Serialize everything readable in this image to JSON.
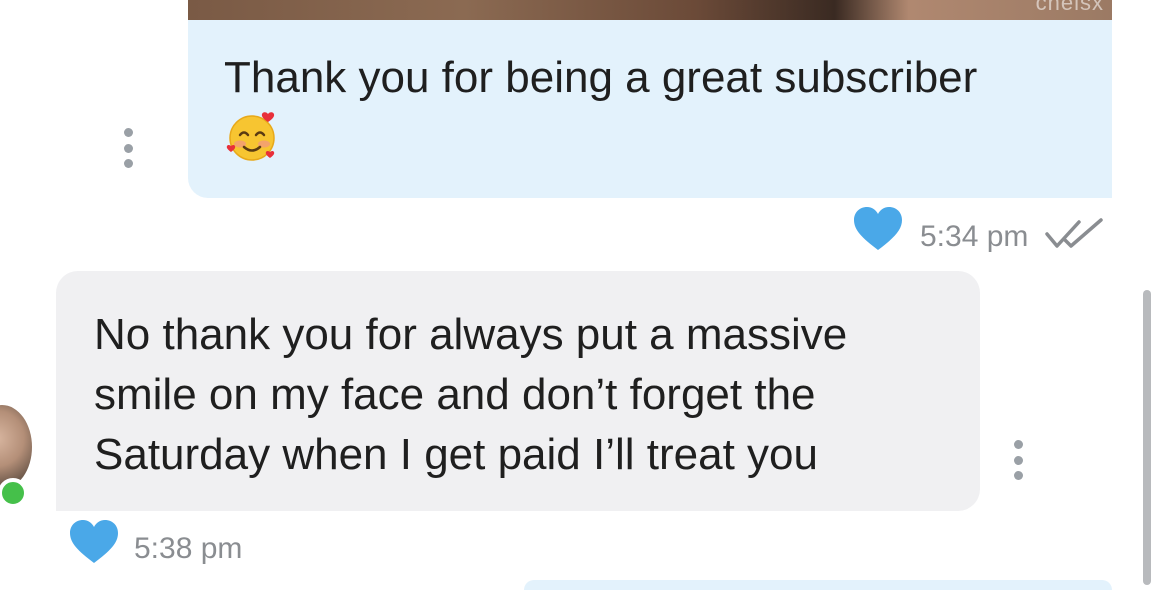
{
  "top_image": {
    "watermark": "chelsx"
  },
  "outgoing_message": {
    "text": "Thank you for being a great subscriber",
    "emoji": "smiling-face-with-hearts",
    "time": "5:34 pm",
    "status": "read",
    "liked": true
  },
  "incoming_message": {
    "text": "No thank you for always put a massive smile on my face and don’t forget the Saturday when I get paid I’ll treat you",
    "time": "5:38 pm",
    "liked": true,
    "sender_online": true
  },
  "colors": {
    "outgoing_bubble": "#e3f2fc",
    "incoming_bubble": "#f0f0f2",
    "heart": "#4aa8e8",
    "online": "#45c04a",
    "timestamp": "#8a8d91"
  }
}
